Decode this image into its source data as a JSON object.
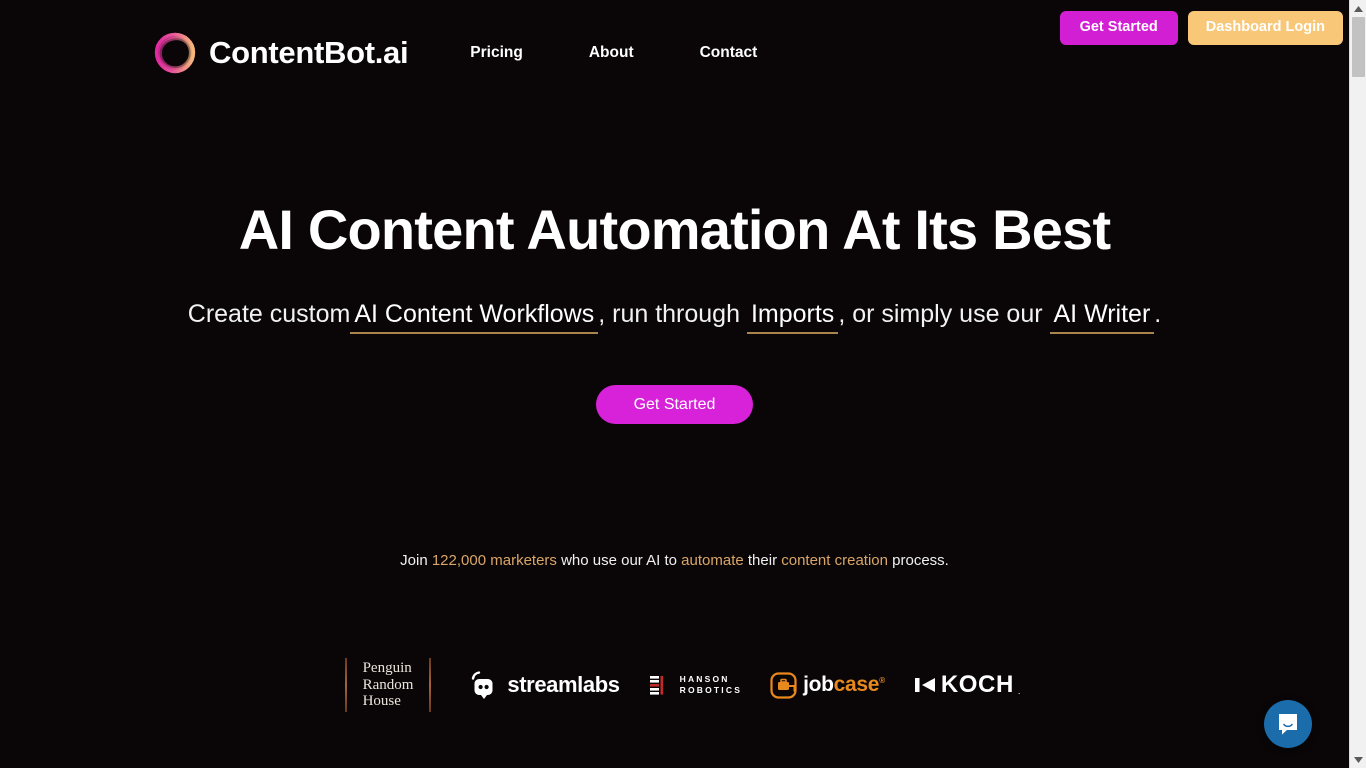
{
  "brand": {
    "name": "ContentBot.ai",
    "logo_icon": "gradient-ring-icon",
    "gradient_from": "#e0299f",
    "gradient_to": "#f5b77a"
  },
  "auth": {
    "get_started_label": "Get Started",
    "dashboard_login_label": "Dashboard Login",
    "get_started_color": "#d31fd3",
    "dashboard_login_color": "#f8c878"
  },
  "nav": {
    "items": [
      {
        "label": "Pricing"
      },
      {
        "label": "About"
      },
      {
        "label": "Contact"
      }
    ]
  },
  "hero": {
    "title": "AI Content Automation At Its Best",
    "sub_parts": [
      {
        "text": "Create custom",
        "highlight": false
      },
      {
        "text": "AI Content Workflows",
        "highlight": true
      },
      {
        "text": ", run through ",
        "highlight": false
      },
      {
        "text": "Imports",
        "highlight": true
      },
      {
        "text": ", or simply use our ",
        "highlight": false
      },
      {
        "text": "AI Writer",
        "highlight": true
      },
      {
        "text": ".",
        "highlight": false
      }
    ],
    "underline_color": "#a9854d",
    "cta_label": "Get Started",
    "cta_color": "#d722d9"
  },
  "social_proof": {
    "parts": [
      {
        "text": "Join ",
        "gold": false
      },
      {
        "text": "122,000 marketers",
        "gold": true
      },
      {
        "text": " who use our AI to ",
        "gold": false
      },
      {
        "text": "automate",
        "gold": true
      },
      {
        "text": " their ",
        "gold": false
      },
      {
        "text": "content creation",
        "gold": true
      },
      {
        "text": " process.",
        "gold": false
      }
    ],
    "gold_color": "#d9a668"
  },
  "client_logos": [
    {
      "name": "Penguin Random House",
      "lines": [
        "Penguin",
        "Random",
        "House"
      ]
    },
    {
      "name": "Streamlabs",
      "wordmark": "streamlabs"
    },
    {
      "name": "Hanson Robotics",
      "lines": [
        "HANSON",
        "ROBOTICS"
      ]
    },
    {
      "name": "Jobcase",
      "word_a": "job",
      "word_b": "case",
      "tm": "®"
    },
    {
      "name": "Koch",
      "wordmark": "KOCH",
      "tm": "."
    }
  ],
  "chat_widget": {
    "icon": "intercom-chat-icon",
    "color": "#1b6cab"
  },
  "scrollbar": {
    "up_arrow": "▲",
    "down_arrow": "▼"
  }
}
